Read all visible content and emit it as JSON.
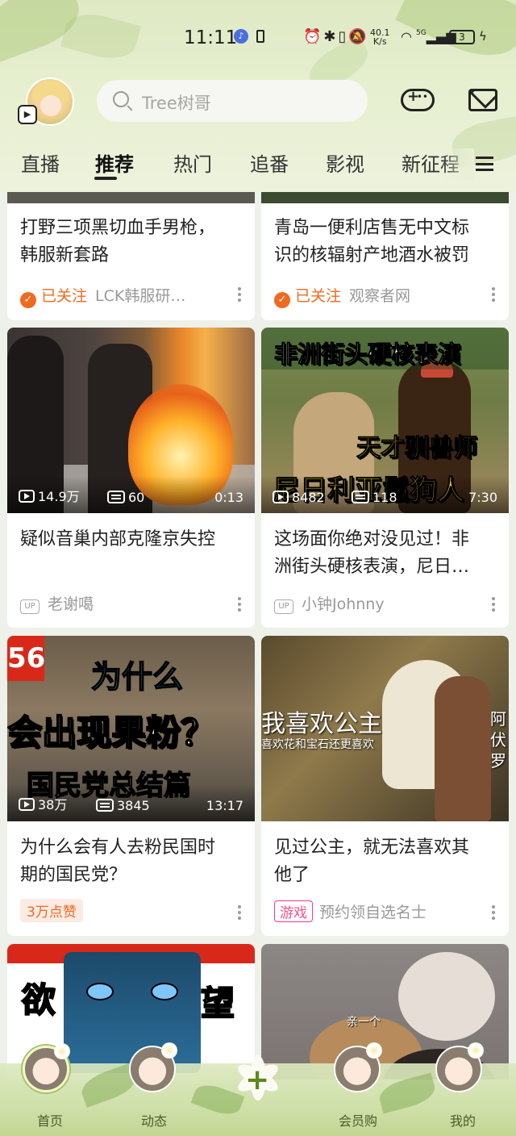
{
  "status_bar": {
    "time": "11:11",
    "net_speed_value": "40.1",
    "net_speed_unit": "K/s",
    "signal": "5G",
    "battery": "3"
  },
  "header": {
    "search_placeholder": "Tree树哥",
    "icons": [
      "avatar",
      "search-icon",
      "game-controller-icon",
      "mail-icon"
    ]
  },
  "tabs": [
    {
      "label": "直播",
      "active": false
    },
    {
      "label": "推荐",
      "active": true
    },
    {
      "label": "热门",
      "active": false
    },
    {
      "label": "追番",
      "active": false
    },
    {
      "label": "影视",
      "active": false
    },
    {
      "label": "新征程",
      "active": false
    }
  ],
  "feed": {
    "row0": [
      {
        "title_line1": "打野三项黑切血手男枪，",
        "title_line2": "韩服新套路",
        "followed_label": "已关注",
        "author": "LCK韩服研…"
      },
      {
        "title_line1": "青岛一便利店售无中文标",
        "title_line2": "识的核辐射产地酒水被罚",
        "followed_label": "已关注",
        "author": "观察者网"
      }
    ],
    "row1": [
      {
        "views": "14.9万",
        "danmaku": "60",
        "duration": "0:13",
        "title_line1": "疑似音巢内部克隆京失控",
        "title_line2": "",
        "up_label": "UP",
        "author": "老谢噶"
      },
      {
        "views": "8482",
        "danmaku": "118",
        "duration": "7:30",
        "thumb_caption_top": "非洲街头硬核表演",
        "thumb_caption_mid": "天才驯兽师",
        "thumb_caption_bottom": "尼日利亚鬣狗人",
        "title_line1": "这场面你绝对没见过！非",
        "title_line2": "洲街头硬核表演，尼日…",
        "up_label": "UP",
        "author": "小钟Johnny"
      }
    ],
    "row2": [
      {
        "views": "38万",
        "danmaku": "3845",
        "duration": "13:17",
        "thumb_badge": "56",
        "thumb_caption_1": "为什么",
        "thumb_caption_2": "会出现果粉？",
        "thumb_caption_3": "国民党总结篇",
        "title_line1": "为什么会有人去粉民国时",
        "title_line2": "期的国民党？",
        "badge": "3万点赞"
      },
      {
        "thumb_caption_1": "我喜欢公主",
        "thumb_caption_2": "喜欢花和宝石还更喜欢",
        "thumb_caption_3": "阿伏罗",
        "title_line1": "见过公主，就无法喜欢其",
        "title_line2": "他了",
        "tag": "游戏",
        "meta": "预约领自选名士"
      }
    ],
    "row3": [
      {
        "thumb_caption_1": "欲",
        "thumb_caption_2": "望"
      },
      {
        "thumb_caption_1": "亲一个"
      }
    ]
  },
  "bottom_nav": [
    {
      "label": "首页",
      "active": true
    },
    {
      "label": "动态",
      "active": false
    },
    {
      "label": "",
      "active": false
    },
    {
      "label": "会员购",
      "active": false
    },
    {
      "label": "我的",
      "active": false
    }
  ],
  "colors": {
    "accent": "#f06a20",
    "header_bg": "#e2ecc8",
    "nav_bg": "#cfe0a9",
    "game_tag": "#f4508a"
  }
}
